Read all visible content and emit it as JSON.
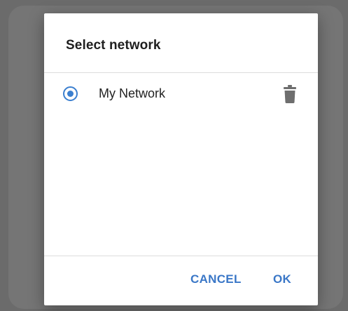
{
  "dialog": {
    "title": "Select network",
    "networks": [
      {
        "label": "My Network",
        "selected": true,
        "radio_icon": "radio-selected-icon",
        "delete_icon": "trash-icon"
      }
    ],
    "cancel_label": "CANCEL",
    "ok_label": "OK"
  },
  "colors": {
    "accent": "#3b7fcf",
    "button_text": "#3a77c7",
    "icon_gray": "#6e6e6e",
    "overlay": "#6b6b6b"
  }
}
